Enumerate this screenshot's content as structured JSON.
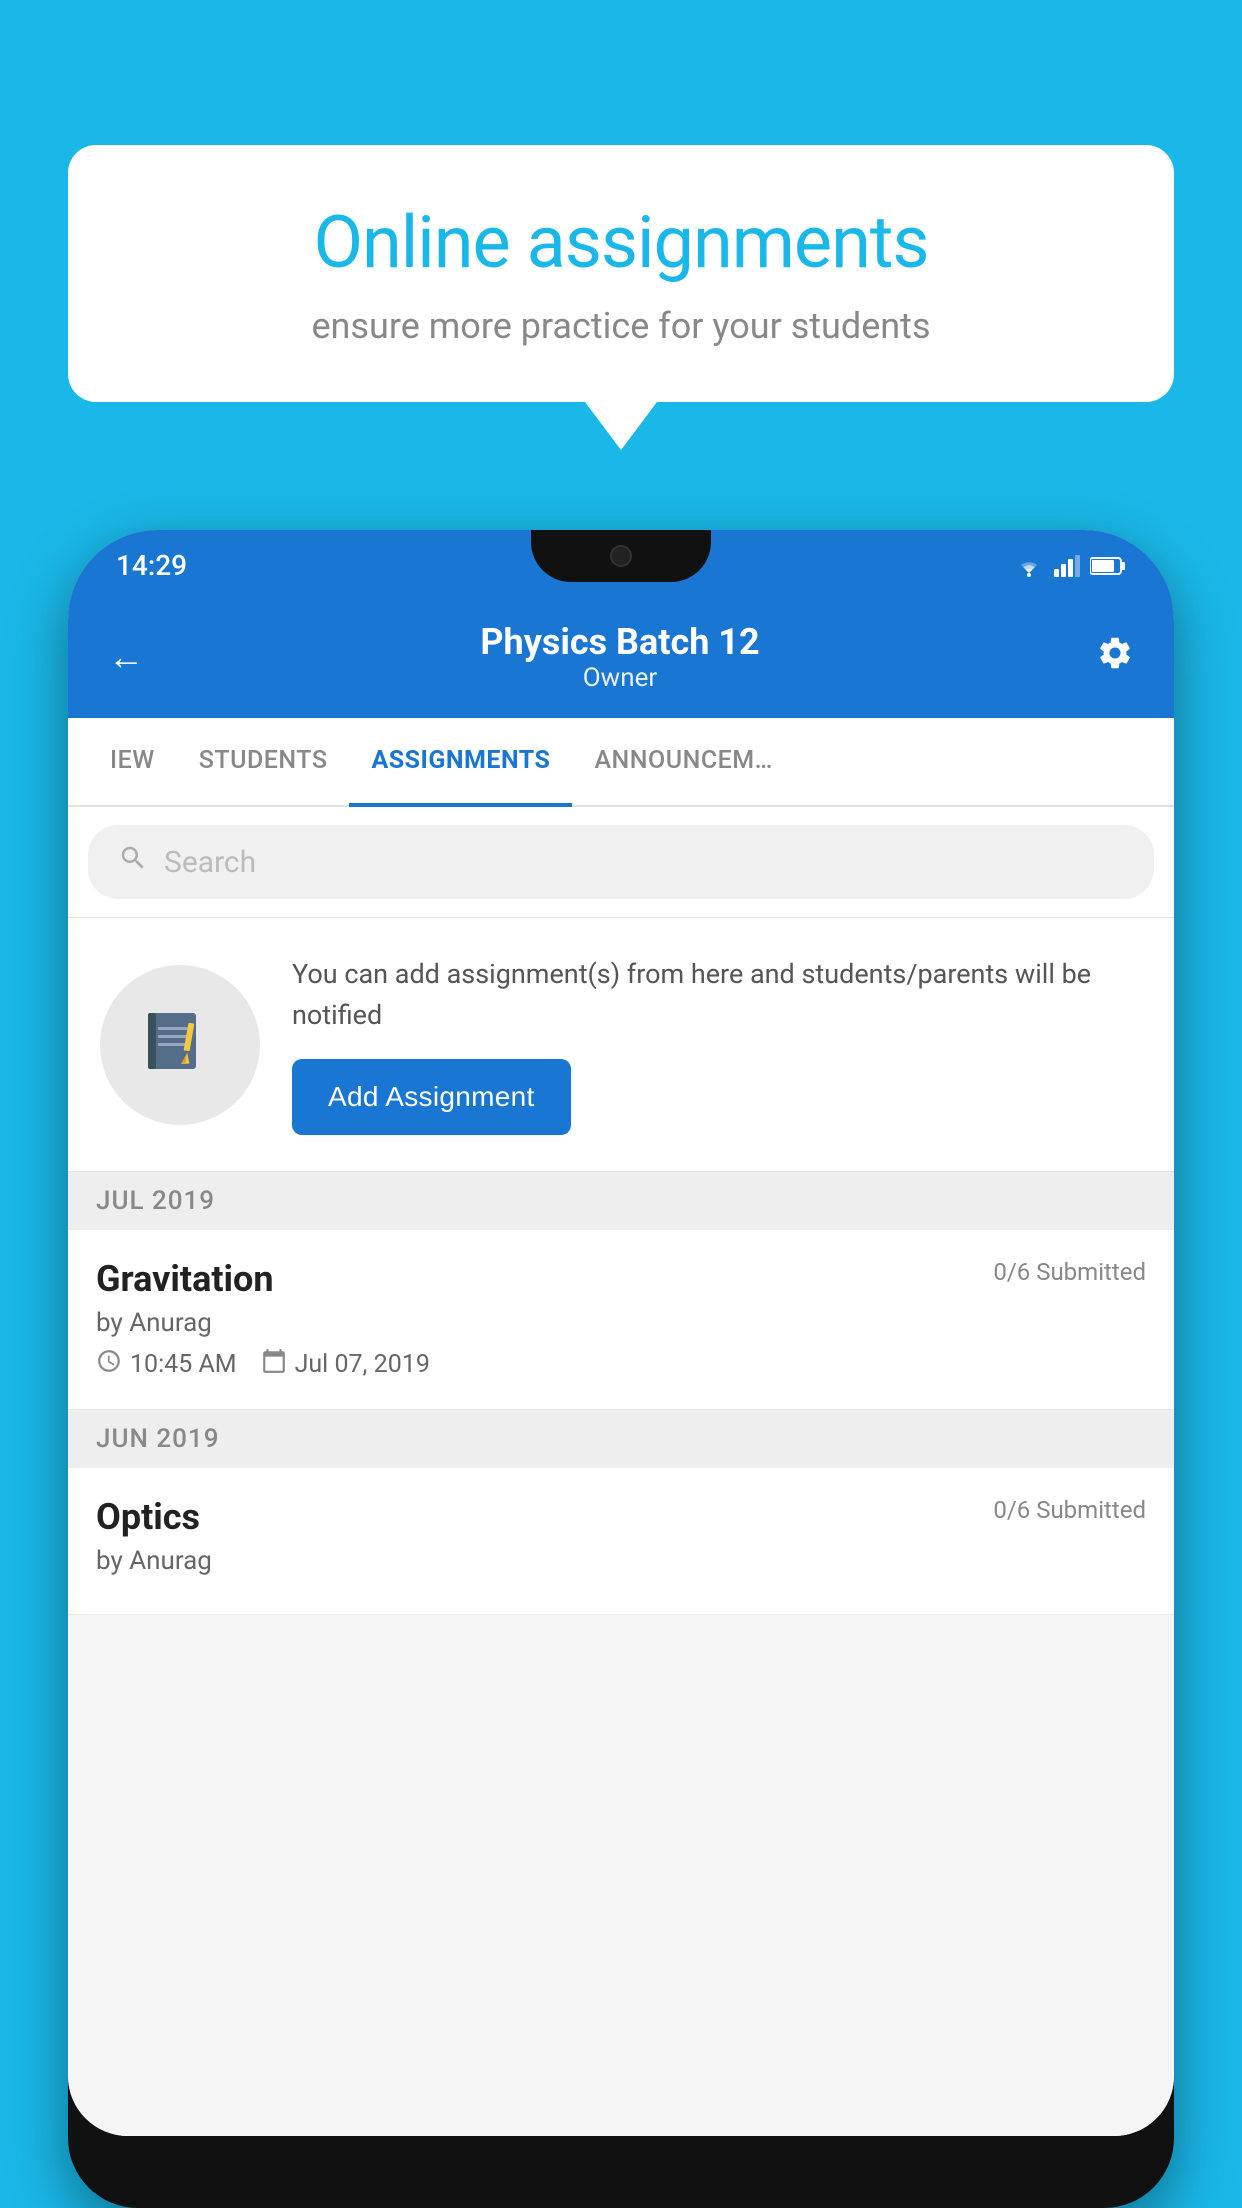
{
  "background_color": "#1ab8e8",
  "speech_bubble": {
    "title": "Online assignments",
    "subtitle": "ensure more practice for your students"
  },
  "phone": {
    "status_bar": {
      "time": "14:29",
      "icons": [
        "wifi",
        "signal",
        "battery"
      ]
    },
    "header": {
      "back_label": "←",
      "title": "Physics Batch 12",
      "subtitle": "Owner",
      "settings_label": "⚙"
    },
    "tabs": [
      {
        "label": "IEW",
        "active": false
      },
      {
        "label": "STUDENTS",
        "active": false
      },
      {
        "label": "ASSIGNMENTS",
        "active": true
      },
      {
        "label": "ANNOUNCEM…",
        "active": false
      }
    ],
    "search": {
      "placeholder": "Search"
    },
    "info_card": {
      "text": "You can add assignment(s) from here and students/parents will be notified",
      "button_label": "Add Assignment"
    },
    "sections": [
      {
        "label": "JUL 2019",
        "items": [
          {
            "name": "Gravitation",
            "submitted": "0/6 Submitted",
            "by": "by Anurag",
            "time": "10:45 AM",
            "date": "Jul 07, 2019"
          }
        ]
      },
      {
        "label": "JUN 2019",
        "items": [
          {
            "name": "Optics",
            "submitted": "0/6 Submitted",
            "by": "by Anurag",
            "time": "",
            "date": ""
          }
        ]
      }
    ]
  }
}
